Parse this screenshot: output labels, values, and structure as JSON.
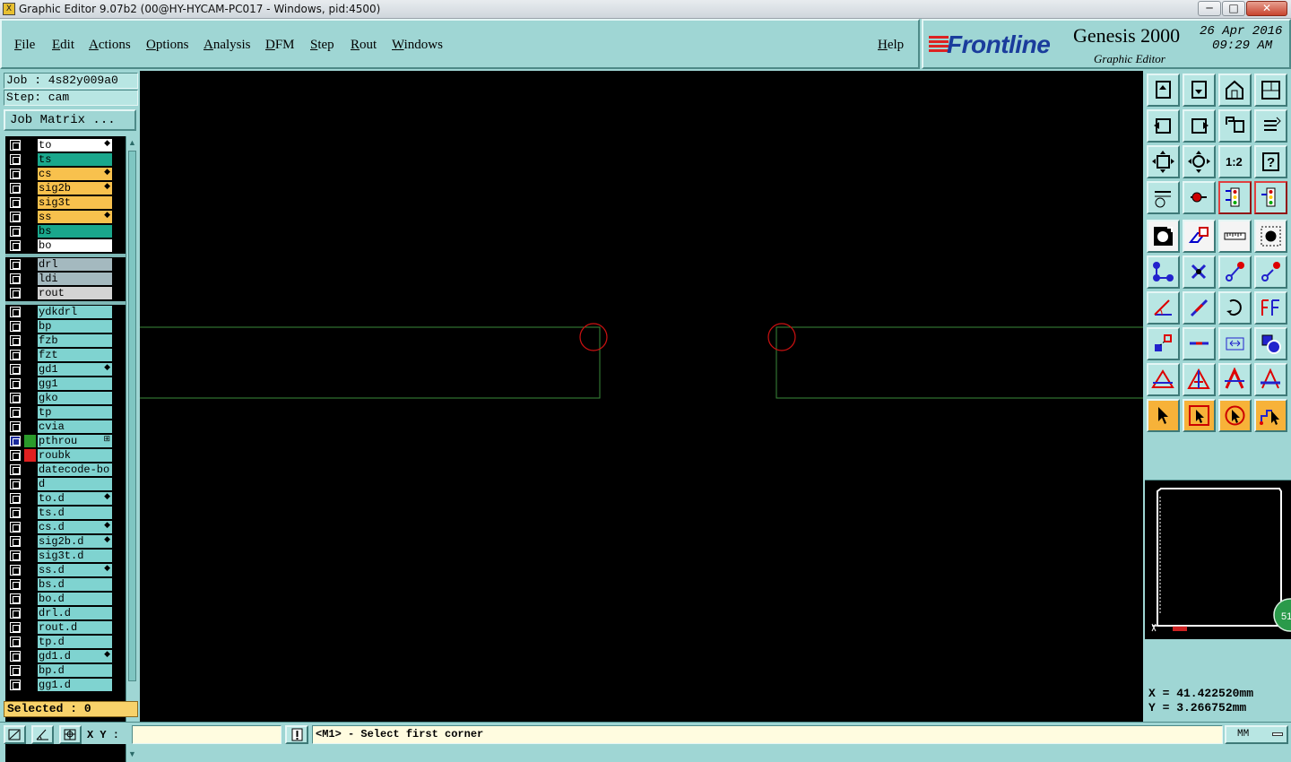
{
  "window": {
    "title": "Graphic Editor 9.07b2 (00@HY-HYCAM-PC017 - Windows, pid:4500)",
    "icon_label": "X",
    "controls": {
      "minimize": "─",
      "maximize": "□",
      "close": "✕"
    }
  },
  "menu": {
    "items": [
      "File",
      "Edit",
      "Actions",
      "Options",
      "Analysis",
      "DFM",
      "Step",
      "Rout",
      "Windows"
    ],
    "help": "Help"
  },
  "brand": {
    "logo": "Frontline",
    "product": "Genesis 2000",
    "subtitle": "Graphic Editor",
    "date": "26 Apr 2016",
    "time": "09:29 AM"
  },
  "job": {
    "job_label": "Job : 4s82y009a0",
    "step_label": "Step: cam",
    "matrix_button": "Job Matrix ..."
  },
  "layers": [
    {
      "name": "to",
      "color": "#ffffff",
      "flag": "◆"
    },
    {
      "name": "ts",
      "color": "#1aa78c",
      "flag": ""
    },
    {
      "name": "cs",
      "color": "#f8c14d",
      "flag": "◆"
    },
    {
      "name": "sig2b",
      "color": "#f8c14d",
      "flag": "◆"
    },
    {
      "name": "sig3t",
      "color": "#f8c14d",
      "flag": ""
    },
    {
      "name": "ss",
      "color": "#f8c14d",
      "flag": "◆"
    },
    {
      "name": "bs",
      "color": "#1aa78c",
      "flag": ""
    },
    {
      "name": "bo",
      "color": "#ffffff",
      "flag": ""
    },
    {
      "name": "drl",
      "color": "#a4b9bf",
      "flag": ""
    },
    {
      "name": "ldi",
      "color": "#a4b9bf",
      "flag": ""
    },
    {
      "name": "rout",
      "color": "#d3d3d3",
      "flag": ""
    },
    {
      "name": "ydkdrl",
      "color": "#7fd3d0",
      "flag": ""
    },
    {
      "name": "bp",
      "color": "#7fd3d0",
      "flag": ""
    },
    {
      "name": "fzb",
      "color": "#7fd3d0",
      "flag": ""
    },
    {
      "name": "fzt",
      "color": "#7fd3d0",
      "flag": ""
    },
    {
      "name": "gd1",
      "color": "#7fd3d0",
      "flag": "◆"
    },
    {
      "name": "gg1",
      "color": "#7fd3d0",
      "flag": ""
    },
    {
      "name": "gko",
      "color": "#7fd3d0",
      "flag": ""
    },
    {
      "name": "tp",
      "color": "#7fd3d0",
      "flag": ""
    },
    {
      "name": "cvia",
      "color": "#7fd3d0",
      "flag": ""
    },
    {
      "name": "pthrou",
      "color": "#7fd3d0",
      "flag": "⊞",
      "swatch": "#2a9a2a",
      "selected": true
    },
    {
      "name": "roubk",
      "color": "#7fd3d0",
      "flag": "",
      "swatch": "#e02020"
    },
    {
      "name": "datecode-bo",
      "color": "#7fd3d0",
      "flag": ""
    },
    {
      "name": "d",
      "color": "#7fd3d0",
      "flag": ""
    },
    {
      "name": "to.d",
      "color": "#7fd3d0",
      "flag": "◆"
    },
    {
      "name": "ts.d",
      "color": "#7fd3d0",
      "flag": ""
    },
    {
      "name": "cs.d",
      "color": "#7fd3d0",
      "flag": "◆"
    },
    {
      "name": "sig2b.d",
      "color": "#7fd3d0",
      "flag": "◆"
    },
    {
      "name": "sig3t.d",
      "color": "#7fd3d0",
      "flag": ""
    },
    {
      "name": "ss.d",
      "color": "#7fd3d0",
      "flag": "◆"
    },
    {
      "name": "bs.d",
      "color": "#7fd3d0",
      "flag": ""
    },
    {
      "name": "bo.d",
      "color": "#7fd3d0",
      "flag": ""
    },
    {
      "name": "drl.d",
      "color": "#7fd3d0",
      "flag": ""
    },
    {
      "name": "rout.d",
      "color": "#7fd3d0",
      "flag": ""
    },
    {
      "name": "tp.d",
      "color": "#7fd3d0",
      "flag": ""
    },
    {
      "name": "gd1.d",
      "color": "#7fd3d0",
      "flag": "◆"
    },
    {
      "name": "bp.d",
      "color": "#7fd3d0",
      "flag": ""
    },
    {
      "name": "gg1.d",
      "color": "#7fd3d0",
      "flag": ""
    }
  ],
  "status": {
    "selected": "Selected : 0"
  },
  "toolbar": {
    "icons": [
      "layer-up-icon",
      "layer-down-icon",
      "home-icon",
      "panel-icon",
      "move-left-icon",
      "move-right-icon",
      "undo-icon",
      "redo-icon",
      "zoom-fit-icon",
      "zoom-home-icon",
      "scale-1-2-icon",
      "help-icon",
      "tools-icon",
      "pad-icon",
      "traffic-light-icon",
      "traffic-light-alt-icon",
      "snap-icon",
      "box-select-icon",
      "ruler-icon",
      "pad-circle-icon",
      "connect-icon",
      "cross-icon",
      "move-point-icon",
      "stretch-icon",
      "angle-icon",
      "line-icon",
      "arc-icon",
      "split-icon",
      "copy-feature-icon",
      "cut-line-icon",
      "measure-icon",
      "shapes-icon",
      "triangle-icon",
      "triangle-a-icon",
      "a-shape-icon",
      "a-line-icon",
      "pointer-icon",
      "select-box-icon",
      "select-circle-icon",
      "select-path-icon"
    ],
    "scale_label": "1:2",
    "help_label": "?"
  },
  "minimap": {
    "badge": "51"
  },
  "coords": {
    "x": "X = 41.422520mm",
    "y": "Y = 3.266752mm"
  },
  "bottom": {
    "xy_label": "X Y :",
    "xy_value": "",
    "message": "<M1> - Select first corner",
    "units": "MM"
  },
  "colors": {
    "background": "#9fd6d4",
    "canvas": "#000000",
    "outline": "#3a8a3a",
    "marker": "#cc1111"
  }
}
